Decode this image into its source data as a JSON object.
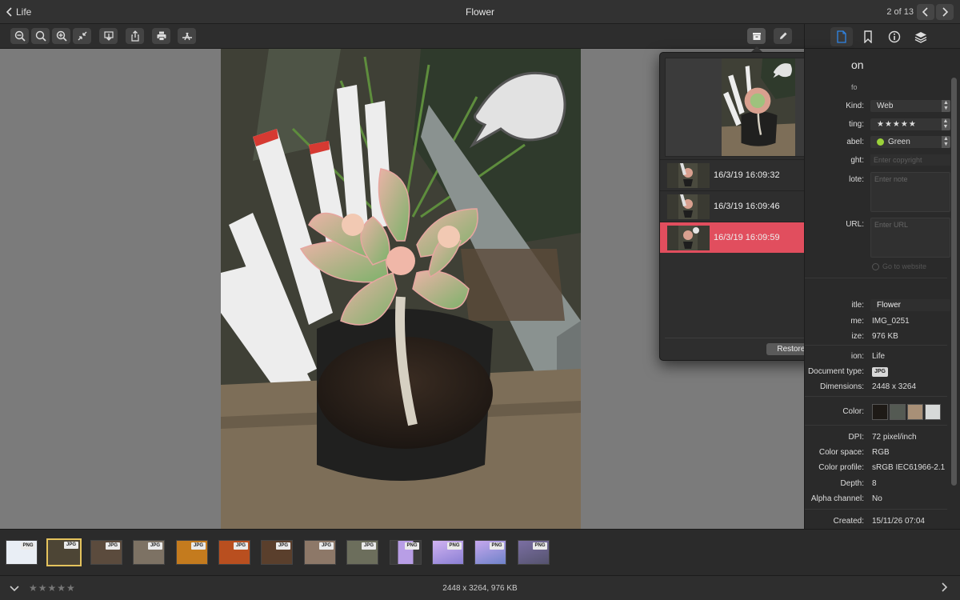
{
  "titlebar": {
    "back_label": "Life",
    "title": "Flower",
    "page_count": "2 of 13"
  },
  "history": {
    "entries": [
      {
        "label": "16/3/19 16:09:32",
        "selected": false
      },
      {
        "label": "16/3/19 16:09:46",
        "selected": false
      },
      {
        "label": "16/3/19 16:09:59",
        "selected": true
      }
    ],
    "restore_label": "Restore Original"
  },
  "inspector": {
    "heading": "on",
    "section_info": "fo",
    "kind_label": "Kind:",
    "kind_value": "Web",
    "rating_label": "ting:",
    "rating_value": "★★★★★",
    "label_label": "abel:",
    "label_value": "Green",
    "label_color": "#9bd23a",
    "copyright_label": "ght:",
    "copyright_placeholder": "Enter copyright",
    "note_label": "lote:",
    "note_placeholder": "Enter note",
    "url_label": "URL:",
    "url_placeholder": "Enter URL",
    "go_to_website": "Go to website",
    "title_label": "itle:",
    "title_value": "Flower",
    "name_label": "me:",
    "name_value": "IMG_0251",
    "size_label": "ize:",
    "size_value": "976 KB",
    "collection_label": "ion:",
    "collection_value": "Life",
    "doctype_label": "Document type:",
    "doctype_value": "JPG",
    "dimensions_label": "Dimensions:",
    "dimensions_value": "2448 x 3264",
    "color_label": "Color:",
    "swatches": [
      "#1e1a16",
      "#545a53",
      "#a89077",
      "#d7d9d8"
    ],
    "dpi_label": "DPI:",
    "dpi_value": "72 pixel/inch",
    "colorspace_label": "Color space:",
    "colorspace_value": "RGB",
    "colorprofile_label": "Color profile:",
    "colorprofile_value": "sRGB IEC61966-2.1",
    "depth_label": "Depth:",
    "depth_value": "8",
    "alpha_label": "Alpha channel:",
    "alpha_value": "No",
    "created_label": "Created:",
    "created_value": "15/11/26 07:04"
  },
  "filmstrip": [
    {
      "badge": "PNG",
      "bg": "#e9eef5"
    },
    {
      "badge": "JPG",
      "bg": "#4d4535",
      "selected": true
    },
    {
      "badge": "JPG",
      "bg": "#5b4b3d"
    },
    {
      "badge": "JPG",
      "bg": "#7d7264"
    },
    {
      "badge": "JPG",
      "bg": "#c47b1e"
    },
    {
      "badge": "JPG",
      "bg": "#b94f1f"
    },
    {
      "badge": "JPG",
      "bg": "#5a3f2c"
    },
    {
      "badge": "JPG",
      "bg": "#8d7868"
    },
    {
      "badge": "JPG",
      "bg": "#6c6e5c"
    },
    {
      "badge": "PNG",
      "bg": "#b89ee6"
    },
    {
      "badge": "PNG",
      "bg": "#8a7fd4"
    },
    {
      "badge": "PNG",
      "bg": "#6f82c9"
    },
    {
      "badge": "PNG",
      "bg": "#55536e"
    }
  ],
  "statusbar": {
    "info": "2448 x 3264, 976 KB",
    "stars": "★★★★★"
  }
}
